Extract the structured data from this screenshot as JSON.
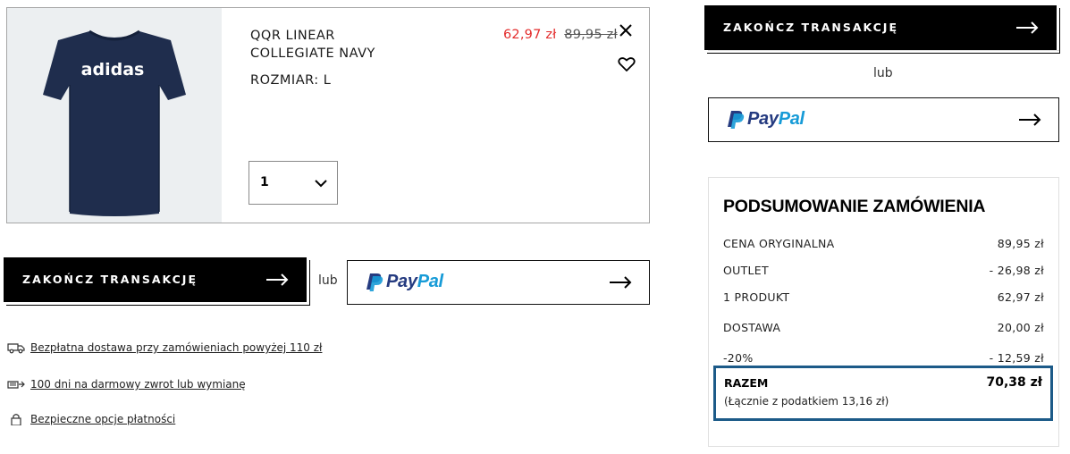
{
  "product": {
    "name_line1": "QQR LINEAR",
    "name_line2": "COLLEGIATE NAVY",
    "size": "ROZMIAR: L",
    "price_sale": "62,97 zł",
    "price_original": "89,95 zł",
    "quantity": "1",
    "image_brand_text": "adidas",
    "icons": {
      "remove": "close-icon",
      "wishlist": "heart-icon",
      "quantity": "chevron-down-icon"
    }
  },
  "actions": {
    "checkout_label": "ZAKOŃCZ TRANSAKCJĘ",
    "or_label": "lub",
    "paypal_label_1": "Pay",
    "paypal_label_2": "Pal"
  },
  "benefits": [
    {
      "text": "Bezpłatna dostawa przy zamówieniach powyżej 110 zł",
      "icon": "delivery-truck-icon"
    },
    {
      "text": "100 dni na darmowy zwrot lub wymianę",
      "icon": "return-icon"
    },
    {
      "text": "Bezpieczne opcje płatności",
      "icon": "lock-icon"
    }
  ],
  "summary": {
    "title": "PODSUMOWANIE ZAMÓWIENIA",
    "rows": [
      {
        "label": "CENA ORYGINALNA",
        "value": "89,95 zł"
      },
      {
        "label": "OUTLET",
        "value": "- 26,98 zł"
      },
      {
        "label": "1 PRODUKT",
        "value": "62,97 zł"
      },
      {
        "label": "DOSTAWA",
        "value": "20,00 zł"
      },
      {
        "label": "-20%",
        "value": "- 12,59 zł"
      }
    ],
    "total_label": "RAZEM",
    "total_value": "70,38 zł",
    "tax_note": "(Łącznie z podatkiem  13,16 zł)"
  },
  "colors": {
    "sale_price": "#e32b2b",
    "highlight_border": "#1c5a88",
    "paypal_dark": "#253b80",
    "paypal_light": "#179bd7",
    "shirt": "#1f2d4d"
  }
}
